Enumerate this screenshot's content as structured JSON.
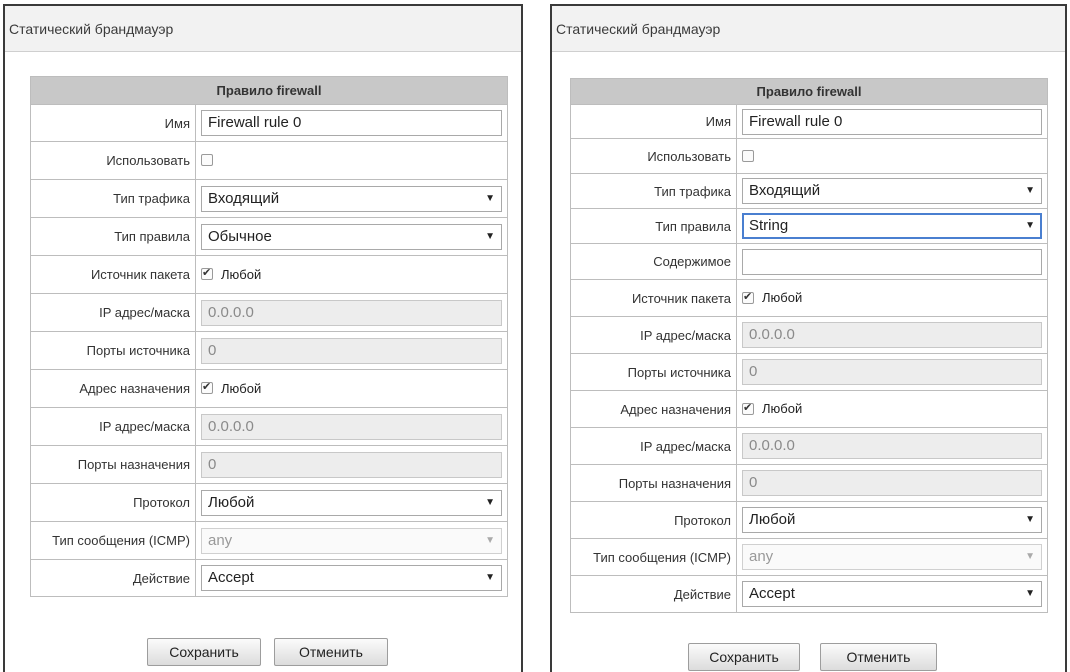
{
  "left": {
    "panel_title": "Статический брандмауэр",
    "table_header": "Правило firewall",
    "fields": {
      "name": {
        "label": "Имя",
        "value": "Firewall rule 0"
      },
      "use": {
        "label": "Использовать",
        "checked": false
      },
      "traffic": {
        "label": "Тип трафика",
        "value": "Входящий"
      },
      "rule_type": {
        "label": "Тип правила",
        "value": "Обычное"
      },
      "src": {
        "label": "Источник пакета",
        "option": "Любой",
        "checked": true
      },
      "src_ip": {
        "label": "IP адрес/маска",
        "value": "0.0.0.0"
      },
      "src_ports": {
        "label": "Порты источника",
        "value": "0"
      },
      "dst": {
        "label": "Адрес назначения",
        "option": "Любой",
        "checked": true
      },
      "dst_ip": {
        "label": "IP адрес/маска",
        "value": "0.0.0.0"
      },
      "dst_ports": {
        "label": "Порты назначения",
        "value": "0"
      },
      "protocol": {
        "label": "Протокол",
        "value": "Любой"
      },
      "icmp": {
        "label": "Тип сообщения (ICMP)",
        "value": "any"
      },
      "action": {
        "label": "Действие",
        "value": "Accept"
      }
    },
    "buttons": {
      "save": "Сохранить",
      "cancel": "Отменить"
    }
  },
  "right": {
    "panel_title": "Статический брандмауэр",
    "table_header": "Правило firewall",
    "fields": {
      "name": {
        "label": "Имя",
        "value": "Firewall rule 0"
      },
      "use": {
        "label": "Использовать",
        "checked": false
      },
      "traffic": {
        "label": "Тип трафика",
        "value": "Входящий"
      },
      "rule_type": {
        "label": "Тип правила",
        "value": "String"
      },
      "content": {
        "label": "Содержимое",
        "value": ""
      },
      "src": {
        "label": "Источник пакета",
        "option": "Любой",
        "checked": true
      },
      "src_ip": {
        "label": "IP адрес/маска",
        "value": "0.0.0.0"
      },
      "src_ports": {
        "label": "Порты источника",
        "value": "0"
      },
      "dst": {
        "label": "Адрес назначения",
        "option": "Любой",
        "checked": true
      },
      "dst_ip": {
        "label": "IP адрес/маска",
        "value": "0.0.0.0"
      },
      "dst_ports": {
        "label": "Порты назначения",
        "value": "0"
      },
      "protocol": {
        "label": "Протокол",
        "value": "Любой"
      },
      "icmp": {
        "label": "Тип сообщения (ICMP)",
        "value": "any"
      },
      "action": {
        "label": "Действие",
        "value": "Accept"
      }
    },
    "buttons": {
      "save": "Сохранить",
      "cancel": "Отменить"
    }
  },
  "icons": {
    "dropdown": "caret-down-icon",
    "checkbox": "checkmark-icon"
  },
  "colors": {
    "header_bg": "#c8c8c8",
    "panel_head_bg": "#f2f2f2",
    "focus": "#4a7fd0"
  }
}
